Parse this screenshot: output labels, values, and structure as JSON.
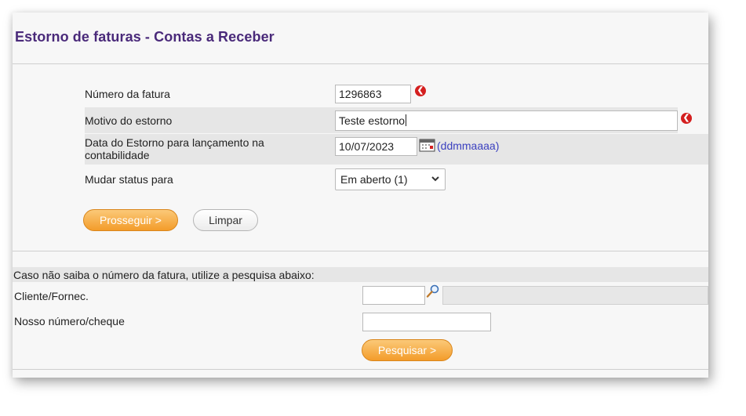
{
  "page": {
    "title": "Estorno de faturas - Contas a Receber"
  },
  "form": {
    "invoice_number": {
      "label": "Número da fatura",
      "value": "1296863"
    },
    "reason": {
      "label": "Motivo do estorno",
      "value": "Teste estorno"
    },
    "date": {
      "label": "Data do Estorno para lançamento na contabilidade",
      "value": "10/07/2023",
      "format_hint": "(ddmmaaaa)"
    },
    "status": {
      "label": "Mudar status para",
      "selected": "Em aberto (1)"
    },
    "proceed_label": "Prosseguir >",
    "clear_label": "Limpar"
  },
  "search": {
    "instruction": "Caso não saiba o número da fatura, utilize a pesquisa abaixo:",
    "client": {
      "label": "Cliente/Fornec.",
      "value": "",
      "name_value": ""
    },
    "our_number": {
      "label": "Nosso número/cheque",
      "value": ""
    },
    "search_label": "Pesquisar >"
  },
  "colors": {
    "title": "#4a2a7a",
    "accent_orange": "#f39c2a",
    "required_red": "#d41f1f",
    "hint_link": "#3a3fbf"
  }
}
